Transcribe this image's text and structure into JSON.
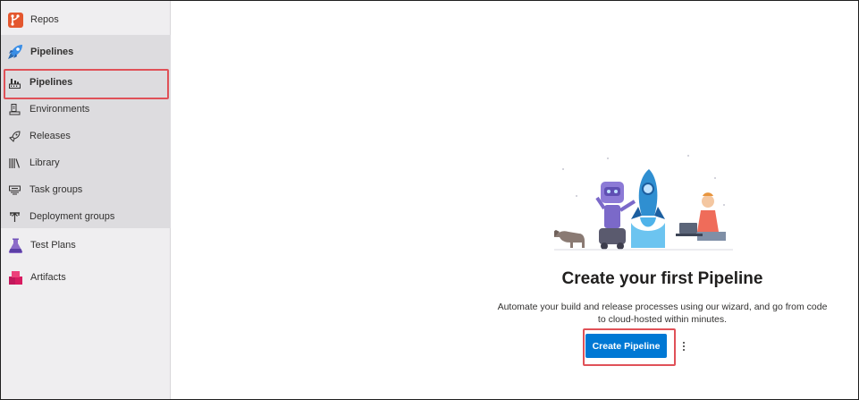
{
  "sidebar": {
    "repos": {
      "label": "Repos",
      "icon": "repos-icon"
    },
    "pipelines_group": {
      "label": "Pipelines",
      "icon": "pipelines-icon"
    },
    "items": [
      {
        "label": "Pipelines",
        "icon": "pipelines-building-icon",
        "selected": true
      },
      {
        "label": "Environments",
        "icon": "environments-icon"
      },
      {
        "label": "Releases",
        "icon": "rocket-icon"
      },
      {
        "label": "Library",
        "icon": "library-icon"
      },
      {
        "label": "Task groups",
        "icon": "task-groups-icon"
      },
      {
        "label": "Deployment groups",
        "icon": "deployment-groups-icon"
      }
    ],
    "test_plans": {
      "label": "Test Plans",
      "icon": "flask-icon"
    },
    "artifacts": {
      "label": "Artifacts",
      "icon": "artifacts-icon"
    }
  },
  "main": {
    "title": "Create your first Pipeline",
    "description_line1": "Automate your build and release processes using our wizard, and go from code",
    "description_line2": "to cloud-hosted within minutes.",
    "primary_button": "Create Pipeline",
    "more_icon": "more-vertical-icon"
  },
  "colors": {
    "accent": "#0078d4",
    "highlight": "#e05158",
    "sidebar_bg": "#efeef0",
    "group_bg": "#dddcdf"
  }
}
